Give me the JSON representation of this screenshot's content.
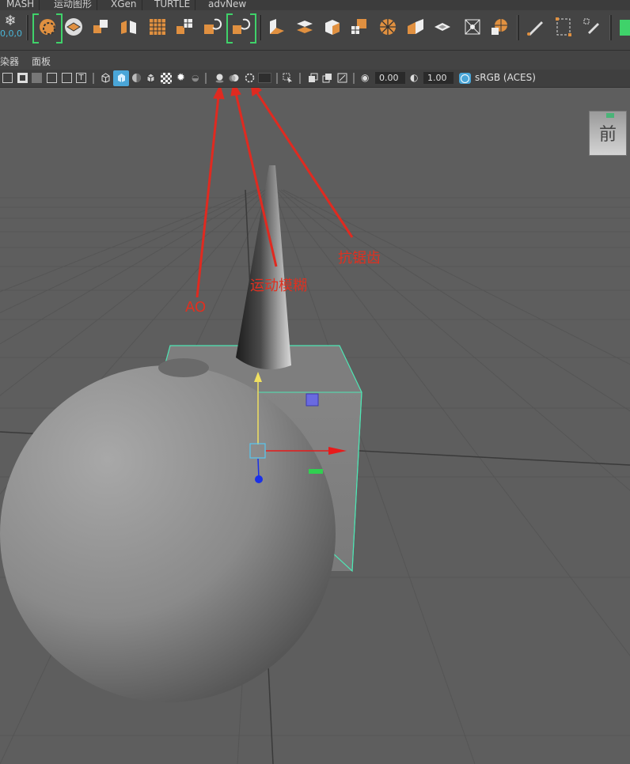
{
  "shelf_tabs": [
    "MASH",
    "运动图形",
    "XGen",
    "TURTLE",
    "advNew"
  ],
  "coord_readout": "0,0,0",
  "menu": {
    "renderer": "染器",
    "panels": "面板"
  },
  "panel_toolbar": {
    "exposure": "0.00",
    "gamma": "1.00",
    "color_space": "sRGB (ACES)"
  },
  "viewcube_label": "前",
  "annotations": {
    "ao": "AO",
    "motion_blur": "运动模糊",
    "anti_aliasing": "抗锯齿"
  },
  "colors": {
    "annotation": "#e02a20",
    "selection_wire": "#4ee6b4",
    "axis_x": "#e81a1a",
    "axis_y": "#f0e060",
    "axis_z": "#1a30e8",
    "shelf_highlight": "#3fd26a"
  }
}
